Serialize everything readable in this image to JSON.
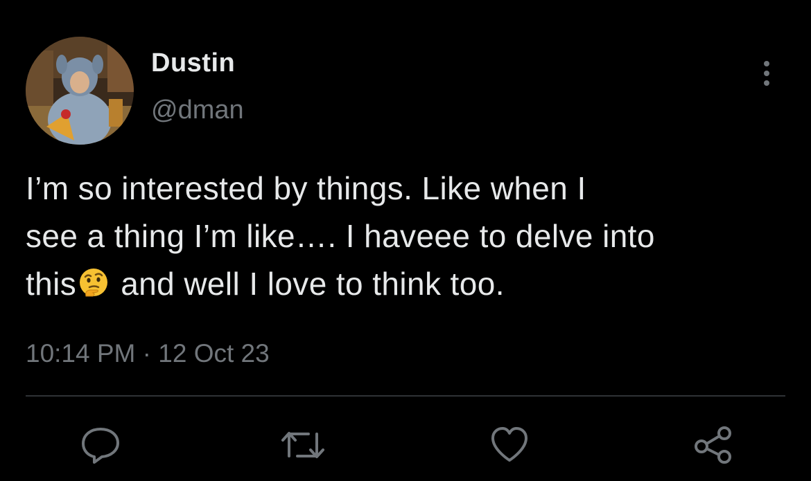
{
  "author": {
    "display_name": "Dustin",
    "handle": "@dman",
    "avatar_icon": "profile-photo"
  },
  "tweet": {
    "lines": [
      "I’m so interested by things. Like when I",
      "see a thing I’m like…. I haveee to delve into"
    ],
    "line3_before_emoji": "this",
    "emoji": "thinking-face-emoji",
    "line3_after_emoji": "and well I love to think too."
  },
  "meta": {
    "time": "10:14 PM",
    "separator": "·",
    "date": "12 Oct 23"
  },
  "actions": {
    "reply_icon": "speech-bubble-icon",
    "retweet_icon": "retweet-arrows-icon",
    "like_icon": "heart-icon",
    "share_icon": "share-nodes-icon"
  },
  "colors": {
    "background": "#000000",
    "primary_text": "#e7e9ea",
    "secondary_text": "#71767b",
    "divider": "#2f3336"
  }
}
